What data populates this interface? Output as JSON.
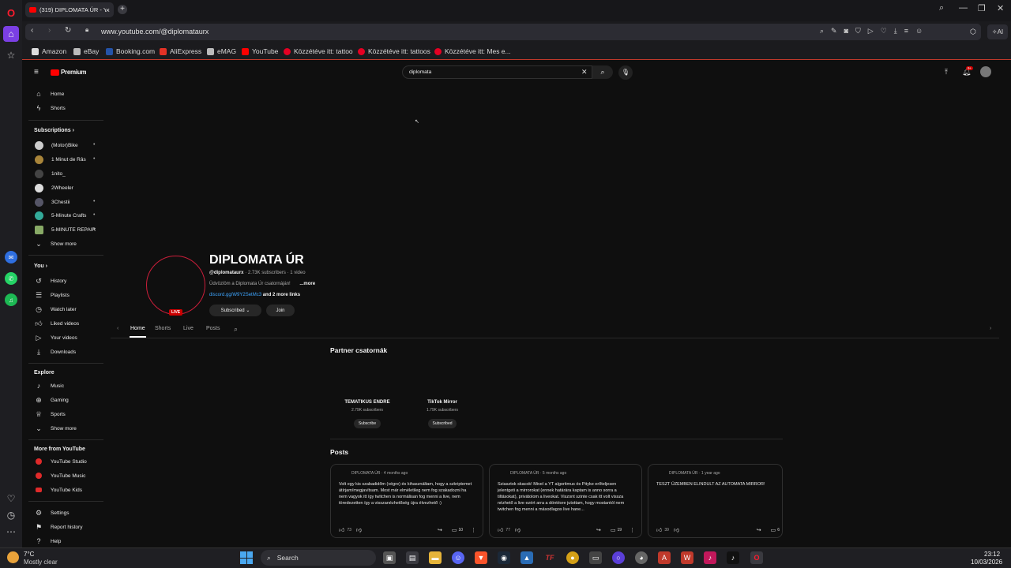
{
  "browser": {
    "tab_title": "(319) DIPLOMATA ÚR - Yo",
    "url": "www.youtube.com/@diplomataurx",
    "bookmarks": [
      "Amazon",
      "eBay",
      "Booking.com",
      "AliExpress",
      "eMAG",
      "YouTube",
      "Közzétéve itt: tattoo",
      "Közzétéve itt: tattoos",
      "Közzétéve itt: Mes e..."
    ],
    "ai_label": "AI"
  },
  "youtube": {
    "logo_text": "Premium",
    "search_value": "diplomata",
    "notif_badge": "9+",
    "sidebar": {
      "main": [
        "Home",
        "Shorts"
      ],
      "subscriptions_header": "Subscriptions",
      "subscriptions": [
        "(Motor)Bike",
        "1 Minut de Râs",
        "1nito_",
        "2Wheeler",
        "3Chestii",
        "5-Minute Crafts",
        "5-MINUTE REPAIR"
      ],
      "show_more": "Show more",
      "you_header": "You",
      "you_items": [
        "History",
        "Playlists",
        "Watch later",
        "Liked videos",
        "Your videos",
        "Downloads"
      ],
      "explore_header": "Explore",
      "explore_items": [
        "Music",
        "Gaming",
        "Sports",
        "Show more"
      ],
      "more_header": "More from YouTube",
      "more_items": [
        "YouTube Studio",
        "YouTube Music",
        "YouTube Kids"
      ],
      "bottom_items": [
        "Settings",
        "Report history",
        "Help"
      ]
    },
    "channel": {
      "name": "DIPLOMATA ÚR",
      "live_badge": "LIVE",
      "handle": "@diplomataurx",
      "stats": "· 2.73K subscribers · 1 video",
      "description": "Üdvözlöm a Diplomata Úr csatornáján!",
      "more": "...more",
      "link": "discord.gg/W9Y2SetMc3",
      "more_links": "and 2 more links",
      "subscribed_label": "Subscribed",
      "join_label": "Join",
      "tabs": [
        "Home",
        "Shorts",
        "Live",
        "Posts"
      ]
    },
    "partner_section": {
      "title": "Partner csatornák",
      "channels": [
        {
          "name": "TEMATIKUS ENDRE",
          "subs": "2.79K subscribers",
          "button": "Subscribe"
        },
        {
          "name": "TikTok Mirror",
          "subs": "1.79K subscribers",
          "button": "Subscribed"
        }
      ]
    },
    "posts_section": {
      "title": "Posts",
      "posts": [
        {
          "author_time": "DIPLOMATA ÚR · 4 months ago",
          "text": "Volt egy kis szabadidőm (végre) és kihasználtam, hogy a szkriptemet átírjam/megjavítsam. Most már elméletileg nem fog szakadozni ha nem vagyok itt így twitchen is normálisan fog menni a live, nem töredezetten így a visszanézhetőség újra élvezhető :)",
          "likes": "73",
          "comments": "10"
        },
        {
          "author_time": "DIPLOMATA ÚR · 5 months ago",
          "text": "Sziasztok skacok! Mivel a YT algoritmus és Pityke erőteljesen jelentgeti a mirrorokat (ennek határára kaptam is anno sorra a tiltásokat), privátolom a liveokat. Viszont szinte csak itt volt vissza nézhető a live ezért arra a döntésre jutottam, hogy mostantól nem twitchen fog menni a másodlagos live hane...",
          "likes": "77",
          "comments": "19"
        },
        {
          "author_time": "DIPLOMATA ÚR · 1 year ago",
          "text": "TESZT ÜZEMBEN ELINDULT AZ AUTOMATA MIRROR!",
          "likes": "39",
          "comments": "6"
        }
      ]
    }
  },
  "taskbar": {
    "weather_temp": "7°C",
    "weather_desc": "Mostly clear",
    "search_label": "Search",
    "time": "23:12",
    "date": "10/03/2026"
  }
}
